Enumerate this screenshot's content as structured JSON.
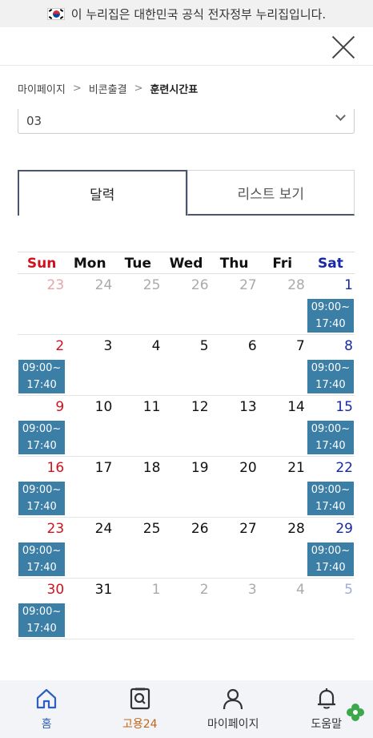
{
  "gov_banner": {
    "text": "이 누리집은 대한민국 공식 전자정부 누리집입니다."
  },
  "breadcrumb": {
    "items": [
      "마이페이지",
      "비콘출결",
      "훈련시간표"
    ],
    "separator": ">"
  },
  "select": {
    "value": "03"
  },
  "view_tabs": [
    {
      "label": "달력",
      "active": true
    },
    {
      "label": "리스트 보기",
      "active": false
    }
  ],
  "calendar": {
    "weekdays": [
      "Sun",
      "Mon",
      "Tue",
      "Wed",
      "Thu",
      "Fri",
      "Sat"
    ],
    "event_time": [
      "09:00~",
      "17:40"
    ],
    "weeks": [
      [
        {
          "d": "23",
          "o": true
        },
        {
          "d": "24",
          "o": true
        },
        {
          "d": "25",
          "o": true
        },
        {
          "d": "26",
          "o": true
        },
        {
          "d": "27",
          "o": true
        },
        {
          "d": "28",
          "o": true
        },
        {
          "d": "1",
          "e": true
        }
      ],
      [
        {
          "d": "2",
          "e": true
        },
        {
          "d": "3"
        },
        {
          "d": "4"
        },
        {
          "d": "5"
        },
        {
          "d": "6"
        },
        {
          "d": "7"
        },
        {
          "d": "8",
          "e": true
        }
      ],
      [
        {
          "d": "9",
          "e": true
        },
        {
          "d": "10"
        },
        {
          "d": "11"
        },
        {
          "d": "12"
        },
        {
          "d": "13"
        },
        {
          "d": "14"
        },
        {
          "d": "15",
          "e": true
        }
      ],
      [
        {
          "d": "16",
          "e": true
        },
        {
          "d": "17"
        },
        {
          "d": "18"
        },
        {
          "d": "19"
        },
        {
          "d": "20"
        },
        {
          "d": "21"
        },
        {
          "d": "22",
          "e": true
        }
      ],
      [
        {
          "d": "23",
          "e": true
        },
        {
          "d": "24"
        },
        {
          "d": "25"
        },
        {
          "d": "26"
        },
        {
          "d": "27"
        },
        {
          "d": "28"
        },
        {
          "d": "29",
          "e": true
        }
      ],
      [
        {
          "d": "30",
          "e": true
        },
        {
          "d": "31"
        },
        {
          "d": "1",
          "o": true
        },
        {
          "d": "2",
          "o": true
        },
        {
          "d": "3",
          "o": true
        },
        {
          "d": "4",
          "o": true
        },
        {
          "d": "5",
          "o": true
        }
      ]
    ]
  },
  "bottom_nav": [
    {
      "label": "홈",
      "icon": "home-icon"
    },
    {
      "label": "고용24",
      "icon": "search-document-icon"
    },
    {
      "label": "마이페이지",
      "icon": "person-icon"
    },
    {
      "label": "도움말",
      "icon": "bell-icon"
    }
  ],
  "colors": {
    "event": "#3b7ea6",
    "sunday": "#d1121e",
    "saturday": "#1629a8",
    "tab_border": "#4a5570",
    "home_nav": "#2e5fc0",
    "work_nav": "#c0661a"
  }
}
